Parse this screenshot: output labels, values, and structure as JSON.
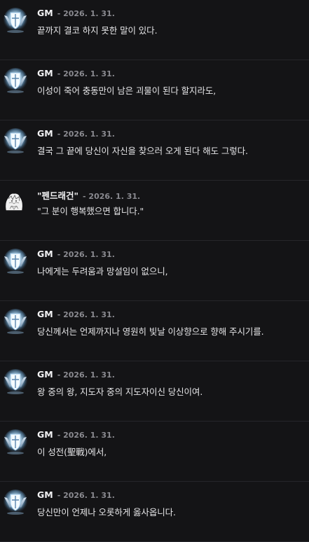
{
  "comments": [
    {
      "author": "GM",
      "date": "- 2026. 1. 31.",
      "text": "끝까지 결코 하지 못한 말이 있다.",
      "avatar": "shield-emblem-icon"
    },
    {
      "author": "GM",
      "date": "- 2026. 1. 31.",
      "text": "이성이 죽어 충동만이 남은 괴물이 된다 할지라도,",
      "avatar": "shield-emblem-icon"
    },
    {
      "author": "GM",
      "date": "- 2026. 1. 31.",
      "text": "결국 그 끝에 당신이 자신을 찾으러 오게 된다 해도 그렇다.",
      "avatar": "shield-emblem-icon"
    },
    {
      "author": "\"펜드래건\"",
      "date": "- 2026. 1. 31.",
      "text": "\"그 분이 행복했으면 합니다.\"",
      "avatar": "sketch-avatar"
    },
    {
      "author": "GM",
      "date": "- 2026. 1. 31.",
      "text": "나에게는 두려움과 망설임이 없으니,",
      "avatar": "shield-emblem-icon"
    },
    {
      "author": "GM",
      "date": "- 2026. 1. 31.",
      "text": "당신께서는 언제까지나 영원히 빛날 이상향으로 향해 주시기를.",
      "avatar": "shield-emblem-icon"
    },
    {
      "author": "GM",
      "date": "- 2026. 1. 31.",
      "text": "왕 중의 왕, 지도자 중의 지도자이신 당신이여.",
      "avatar": "shield-emblem-icon"
    },
    {
      "author": "GM",
      "date": "- 2026. 1. 31.",
      "text": "이 성전(聖戰)에서,",
      "avatar": "shield-emblem-icon"
    },
    {
      "author": "GM",
      "date": "- 2026. 1. 31.",
      "text": "당신만이 언제나 오롯하게 옳사옵니다.",
      "avatar": "shield-emblem-icon"
    }
  ],
  "colors": {
    "background": "#141416",
    "divider": "#26262a",
    "date": "#8a8a90",
    "emblem_glow": "#bfe6ff"
  }
}
